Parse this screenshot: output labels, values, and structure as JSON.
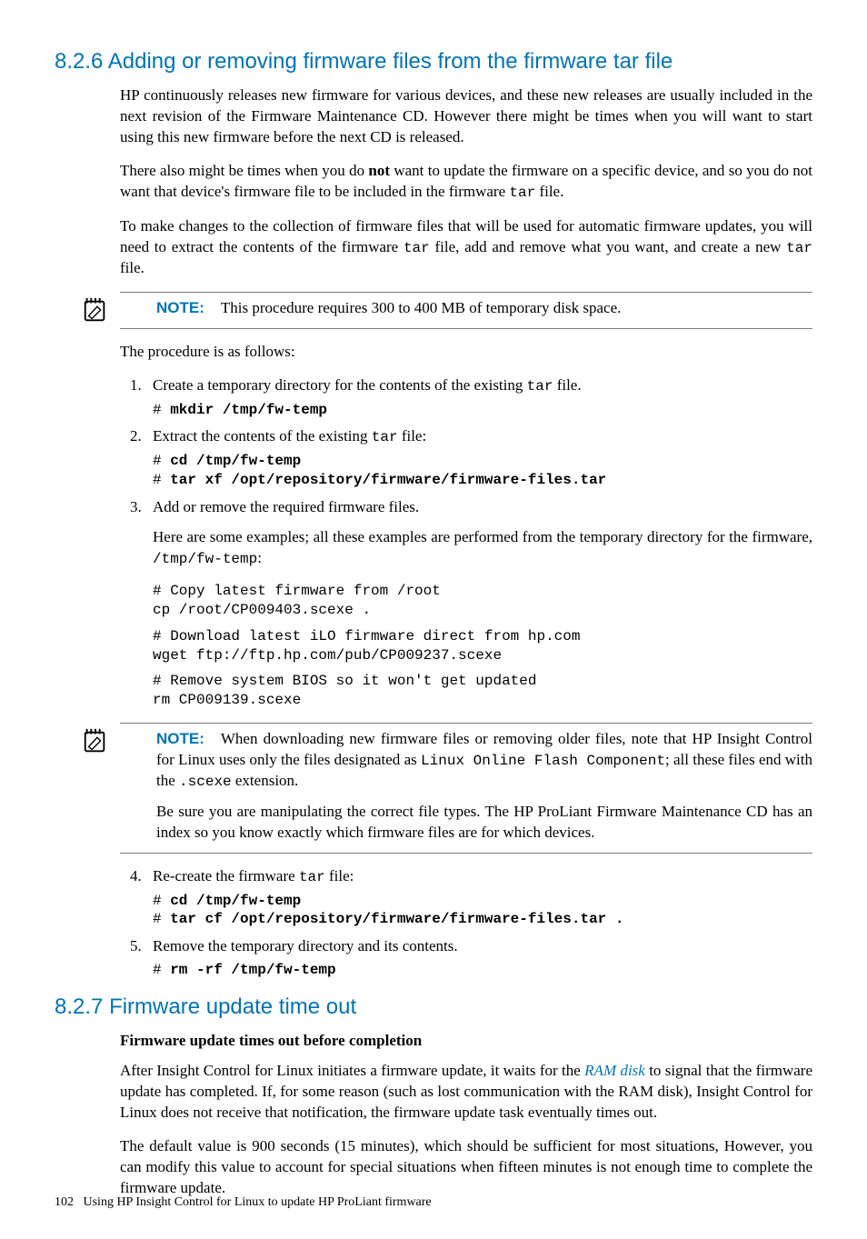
{
  "section1": {
    "number": "8.2.6",
    "title": "Adding or removing firmware files from the firmware tar file",
    "para1a": "HP continuously releases new firmware for various devices, and these new releases are usually included in the next revision of the Firmware Maintenance CD. However there might be times when you will want to start using this new firmware before the next CD is released.",
    "para2_pre": "There also might be times when you do ",
    "para2_not": "not",
    "para2_post": " want to update the firmware on a specific device, and so you do not want that device's firmware file to be included in the firmware ",
    "para2_tar": "tar",
    "para2_end": " file.",
    "para3_pre": "To make changes to the collection of firmware files that will be used for automatic firmware updates, you will need to extract the contents of the firmware ",
    "para3_tar": "tar",
    "para3_mid": " file, add and remove what you want, and create a new ",
    "para3_tar2": "tar",
    "para3_end": " file.",
    "note1": {
      "label": "NOTE:",
      "text": "This procedure requires 300 to 400 MB of temporary disk space."
    },
    "para4": "The procedure is as follows:",
    "steps": {
      "s1": {
        "text_pre": "Create a temporary directory for the contents of the existing ",
        "text_tar": "tar",
        "text_post": " file.",
        "code_prompt": "# ",
        "code": "mkdir /tmp/fw-temp"
      },
      "s2": {
        "text_pre": "Extract the contents of the existing ",
        "text_tar": "tar",
        "text_post": " file:",
        "code_p1": "# ",
        "code_l1": "cd /tmp/fw-temp",
        "code_p2": "# ",
        "code_l2": "tar xf /opt/repository/firmware/firmware-files.tar"
      },
      "s3": {
        "text": "Add or remove the required firmware files.",
        "para_pre": "Here are some examples; all these examples are performed from the temporary directory for the firmware, ",
        "para_path": "/tmp/fw-temp",
        "para_post": ":",
        "code_block1": "# Copy latest firmware from /root\ncp /root/CP009403.scexe .",
        "code_block2": "# Download latest iLO firmware direct from hp.com\nwget ftp://ftp.hp.com/pub/CP009237.scexe",
        "code_block3": "# Remove system BIOS so it won't get updated\nrm CP009139.scexe"
      },
      "s4": {
        "text_pre": "Re-create the firmware ",
        "text_tar": "tar",
        "text_post": " file:",
        "code_p1": "# ",
        "code_l1": "cd /tmp/fw-temp",
        "code_p2": "# ",
        "code_l2": "tar cf /opt/repository/firmware/firmware-files.tar ."
      },
      "s5": {
        "text": "Remove the temporary directory and its contents.",
        "code_prompt": "# ",
        "code": "rm -rf /tmp/fw-temp"
      }
    },
    "note2": {
      "label": "NOTE:",
      "text_pre": "When downloading new firmware files or removing older files, note that HP Insight Control for Linux uses only the files designated as ",
      "text_mono": "Linux Online Flash Component",
      "text_mid": "; all these files end with the ",
      "text_ext": ".scexe",
      "text_post": " extension.",
      "para2": "Be sure you are manipulating the correct file types. The HP ProLiant Firmware Maintenance CD has an index so you know exactly which firmware files are for which devices."
    }
  },
  "section2": {
    "number": "8.2.7",
    "title": "Firmware update time out",
    "subhead": "Firmware update times out before completion",
    "para1_pre": "After Insight Control for Linux initiates a firmware update, it waits for the ",
    "para1_link": "RAM disk",
    "para1_post": " to signal that the firmware update has completed. If, for some reason (such as lost communication with the RAM disk), Insight Control for Linux does not receive that notification, the firmware update task eventually times out.",
    "para2": "The default value is 900 seconds (15 minutes), which should be sufficient for most situations, However, you can modify this value to account for special situations when fifteen minutes is not enough time to complete the firmware update."
  },
  "footer": {
    "page": "102",
    "title": "Using HP Insight Control for Linux to update HP ProLiant firmware"
  }
}
